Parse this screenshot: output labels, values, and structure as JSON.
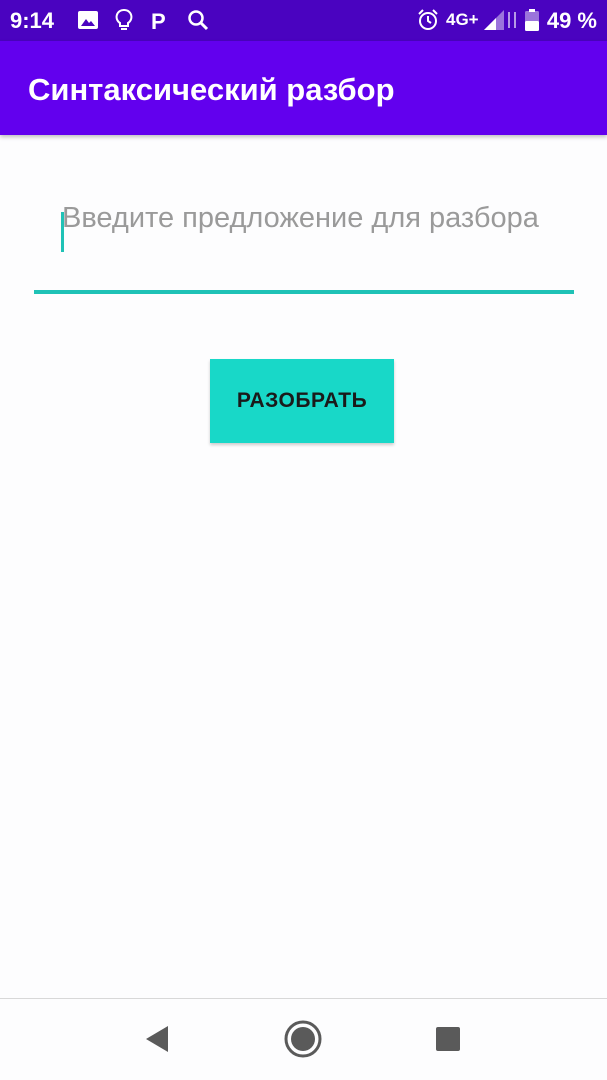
{
  "status_bar": {
    "time": "9:14",
    "network": "4G+",
    "battery": "49 %",
    "icons": [
      "image-icon",
      "lightbulb-icon",
      "parking-icon",
      "search-icon",
      "alarm-icon",
      "signal-icon",
      "battery-icon"
    ]
  },
  "app_bar": {
    "title": "Синтаксический разбор",
    "color": "#6200ee"
  },
  "input": {
    "value": "",
    "placeholder": "Введите предложение для разбора",
    "accent_color": "#1fc2b6"
  },
  "parse_button": {
    "label": "РАЗОБРАТЬ",
    "color": "#18d8c8"
  },
  "nav_bar": {
    "buttons": [
      "back-icon",
      "home-icon",
      "recents-icon"
    ]
  }
}
